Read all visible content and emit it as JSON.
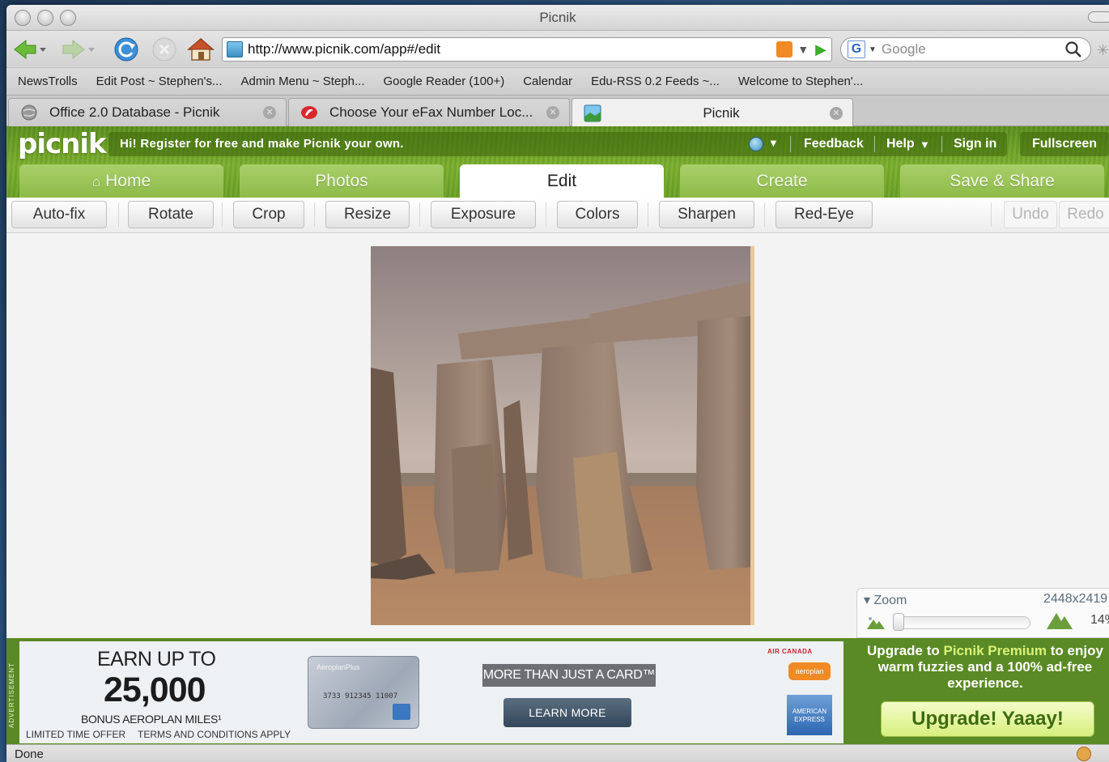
{
  "window": {
    "title": "Picnik"
  },
  "navbar": {
    "url": "http://www.picnik.com/app#/edit",
    "search_placeholder": "Google",
    "search_engine_letter": "G"
  },
  "bookmarks": [
    "NewsTrolls",
    "Edit Post ~ Stephen's...",
    "Admin Menu ~ Steph...",
    "Google Reader (100+)",
    "Calendar",
    "Edu-RSS 0.2 Feeds ~...",
    "Welcome to Stephen'..."
  ],
  "tabs": [
    {
      "label": "Office 2.0 Database - Picnik",
      "active": false
    },
    {
      "label": "Choose Your eFax Number Loc...",
      "active": false
    },
    {
      "label": "Picnik",
      "active": true
    }
  ],
  "picnik": {
    "logo": "picnik",
    "greeting": "Hi! Register for free and make Picnik your own.",
    "links": {
      "feedback": "Feedback",
      "help": "Help",
      "sign_in": "Sign in",
      "fullscreen": "Fullscreen"
    },
    "main_tabs": [
      {
        "label": "Home",
        "active": false
      },
      {
        "label": "Photos",
        "active": false
      },
      {
        "label": "Edit",
        "active": true
      },
      {
        "label": "Create",
        "active": false
      },
      {
        "label": "Save & Share",
        "active": false
      }
    ],
    "edit_tools": [
      "Auto-fix",
      "Rotate",
      "Crop",
      "Resize",
      "Exposure",
      "Colors",
      "Sharpen",
      "Red-Eye"
    ],
    "undo": "Undo",
    "redo": "Redo",
    "zoom": {
      "label": "Zoom",
      "dimensions": "2448x2419",
      "percent": "14%"
    }
  },
  "ad": {
    "vertical_label": "ADVERTISEMENT",
    "earn": "EARN UP TO",
    "number": "25,000",
    "bonus": "BONUS AEROPLAN MILES¹",
    "limited": "LIMITED TIME OFFER",
    "terms": "TERMS AND CONDITIONS APPLY",
    "card_brand": "AeroplanPlus",
    "card_number": "3733 912345 11007",
    "tagline": "MORE THAN JUST A CARD™",
    "learn_more": "LEARN MORE",
    "air_canada": "AIR CANADA",
    "aeroplan": "aeroplan",
    "amex": "AMERICAN EXPRESS"
  },
  "upgrade": {
    "text_pre": "Upgrade to ",
    "text_brand": "Picnik Premium",
    "text_post": " to enjoy warm fuzzies and a 100% ad-free experience.",
    "button": "Upgrade! Yaaay!"
  },
  "status": {
    "text": "Done"
  },
  "colors": {
    "picnik_green": "#6aa024",
    "ad_green": "#5a8a25",
    "upgrade_button": "#d6ef7e"
  }
}
